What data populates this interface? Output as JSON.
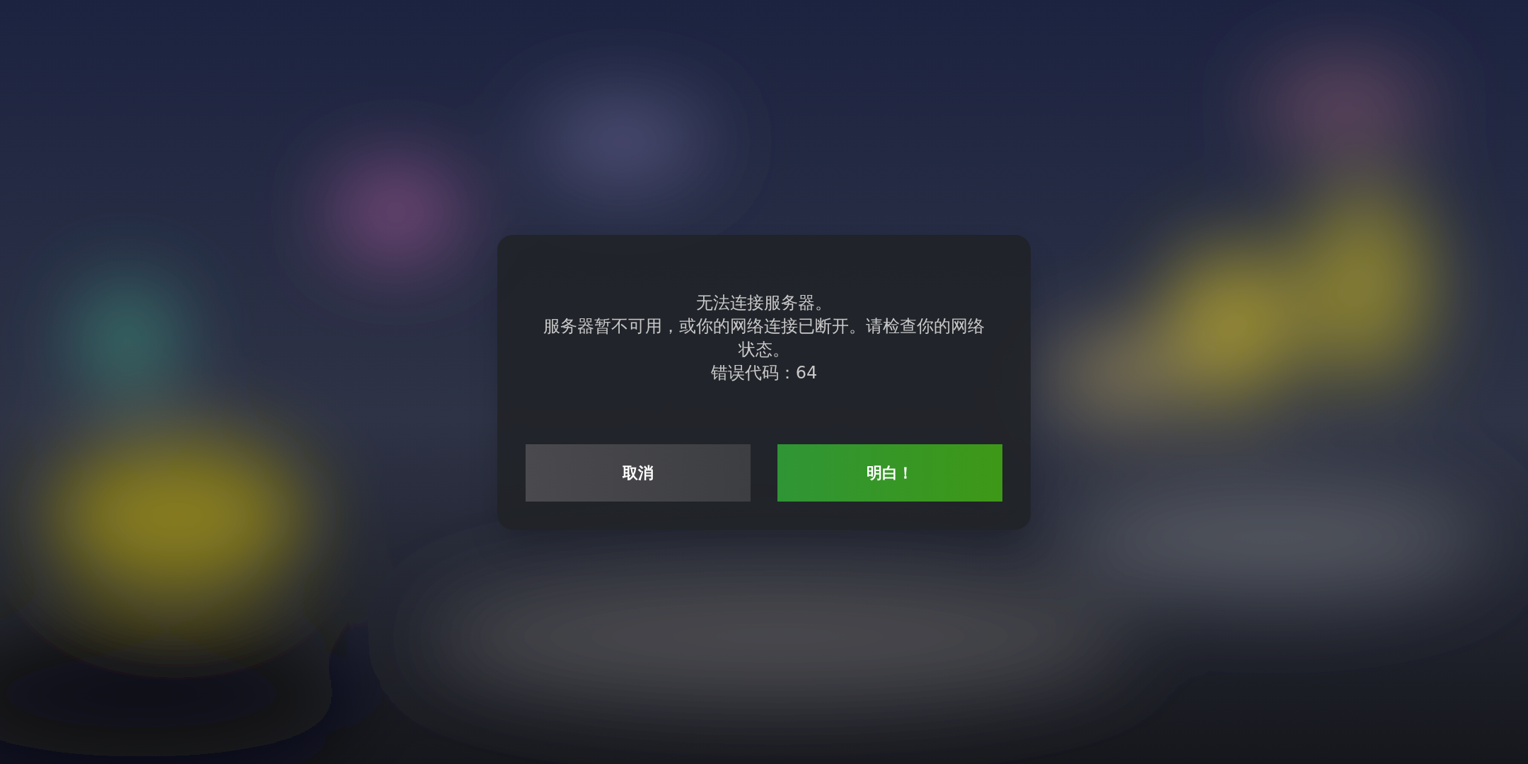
{
  "dialog": {
    "message": [
      "无法连接服务器。",
      "服务器暂不可用，或你的网络连接已断开。请检查你的网络状态。",
      "错误代码：64"
    ],
    "buttons": [
      {
        "label": "取消",
        "kind": "secondary"
      },
      {
        "label": "明白！",
        "kind": "primary"
      }
    ]
  }
}
